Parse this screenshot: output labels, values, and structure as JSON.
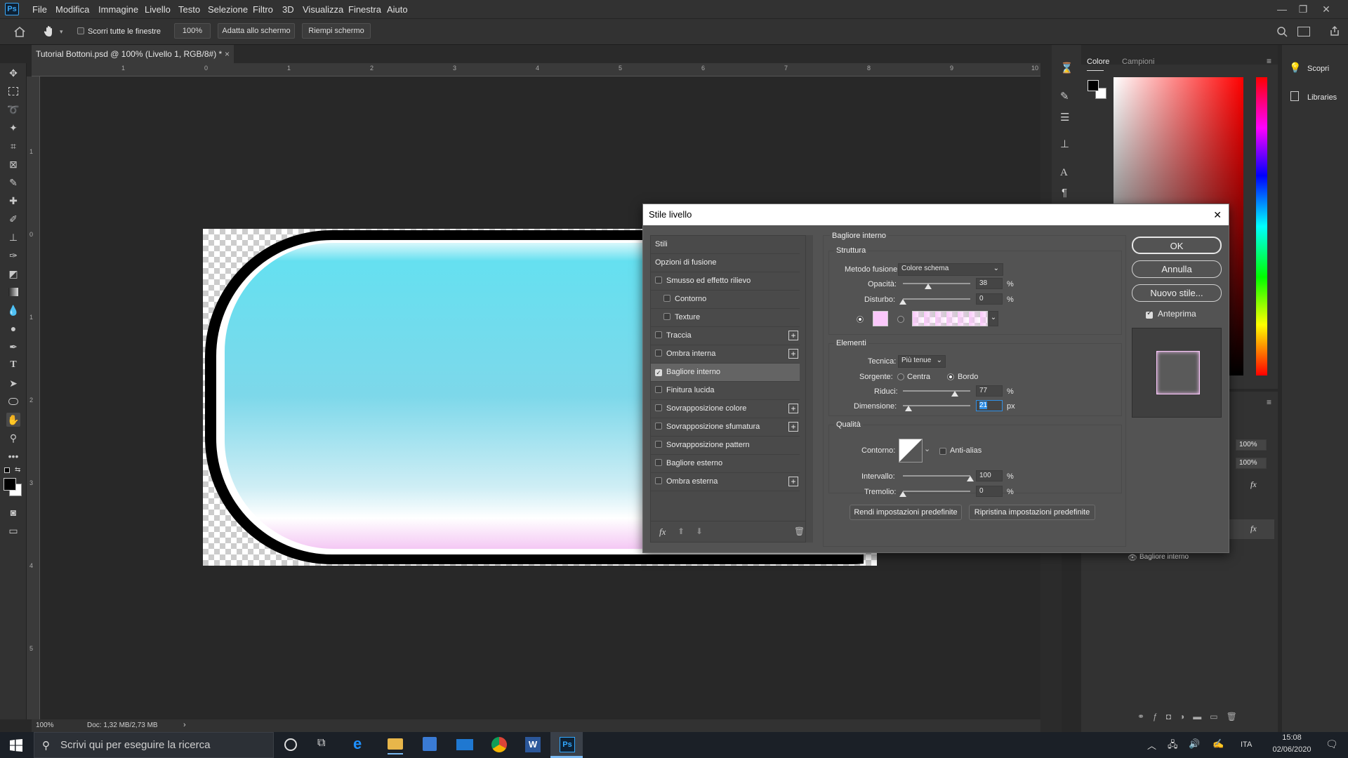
{
  "app": {
    "logo": "Ps"
  },
  "menu": [
    "File",
    "Modifica",
    "Immagine",
    "Livello",
    "Testo",
    "Selezione",
    "Filtro",
    "3D",
    "Visualizza",
    "Finestra",
    "Aiuto"
  ],
  "options": {
    "scroll_all_label": "Scorri tutte le finestre",
    "zoom_value": "100%",
    "fit_label": "Adatta allo schermo",
    "fill_label": "Riempi schermo"
  },
  "document": {
    "tab_title": "Tutorial Bottoni.psd @ 100% (Livello 1, RGB/8#) *",
    "close": "×"
  },
  "ruler_h": [
    "1",
    "0",
    "1",
    "2",
    "3",
    "4",
    "5",
    "6",
    "7",
    "8",
    "9",
    "10"
  ],
  "ruler_v": [
    "1",
    "0",
    "1",
    "2",
    "3",
    "4",
    "5"
  ],
  "status": {
    "zoom": "100%",
    "doc": "Doc: 1,32 MB/2,73 MB",
    "arrow": "›"
  },
  "color_panel": {
    "tabs": [
      "Colore",
      "Campioni"
    ],
    "foreground": "#000000",
    "background": "#ffffff"
  },
  "side_panel": {
    "discover": "Scopri",
    "libraries": "Libraries"
  },
  "layers": {
    "opacity_value": "100%",
    "fill_value": "100%",
    "effect_name": "Bagliore interno",
    "fx": "fx"
  },
  "dialog": {
    "title": "Stile livello",
    "list": {
      "header": "Stili",
      "blend_options": "Opzioni di fusione",
      "items": [
        {
          "label": "Smusso ed effetto rilievo",
          "checked": false,
          "indent": false,
          "plus": false
        },
        {
          "label": "Contorno",
          "checked": false,
          "indent": true,
          "plus": false
        },
        {
          "label": "Texture",
          "checked": false,
          "indent": true,
          "plus": false
        },
        {
          "label": "Traccia",
          "checked": false,
          "indent": false,
          "plus": true
        },
        {
          "label": "Ombra interna",
          "checked": false,
          "indent": false,
          "plus": true
        },
        {
          "label": "Bagliore interno",
          "checked": true,
          "indent": false,
          "plus": false
        },
        {
          "label": "Finitura lucida",
          "checked": false,
          "indent": false,
          "plus": false
        },
        {
          "label": "Sovrapposizione colore",
          "checked": false,
          "indent": false,
          "plus": true
        },
        {
          "label": "Sovrapposizione sfumatura",
          "checked": false,
          "indent": false,
          "plus": true
        },
        {
          "label": "Sovrapposizione pattern",
          "checked": false,
          "indent": false,
          "plus": false
        },
        {
          "label": "Bagliore esterno",
          "checked": false,
          "indent": false,
          "plus": false
        },
        {
          "label": "Ombra esterna",
          "checked": false,
          "indent": false,
          "plus": true
        }
      ],
      "fx_label": "fx"
    },
    "section_title": "Bagliore interno",
    "structure": {
      "title": "Struttura",
      "blend_mode_label": "Metodo fusione:",
      "blend_mode_value": "Colore schema",
      "opacity_label": "Opacità:",
      "opacity_value": "38",
      "opacity_level": 38,
      "noise_label": "Disturbo:",
      "noise_value": "0",
      "noise_level": 0,
      "percent": "%",
      "glow_color": "#fbc8fb"
    },
    "elements": {
      "title": "Elementi",
      "technique_label": "Tecnica:",
      "technique_value": "Più tenue",
      "source_label": "Sorgente:",
      "source_center": "Centra",
      "source_edge": "Bordo",
      "choke_label": "Riduci:",
      "choke_value": "77",
      "choke_level": 77,
      "size_label": "Dimensione:",
      "size_value": "21",
      "size_level": 8,
      "px": "px",
      "percent": "%"
    },
    "quality": {
      "title": "Qualità",
      "contour_label": "Contorno:",
      "antialias_label": "Anti-alias",
      "range_label": "Intervallo:",
      "range_value": "100",
      "range_level": 100,
      "jitter_label": "Tremolio:",
      "jitter_value": "0",
      "jitter_level": 0,
      "percent": "%"
    },
    "make_default": "Rendi impostazioni predefinite",
    "reset_default": "Ripristina impostazioni predefinite",
    "ok": "OK",
    "cancel": "Annulla",
    "new_style": "Nuovo stile...",
    "preview_label": "Anteprima",
    "close": "✕"
  },
  "taskbar": {
    "search_placeholder": "Scrivi qui per eseguire la ricerca",
    "lang": "ITA",
    "time": "15:08",
    "date": "02/06/2020",
    "ps_label": "Ps",
    "word_label": "W"
  }
}
